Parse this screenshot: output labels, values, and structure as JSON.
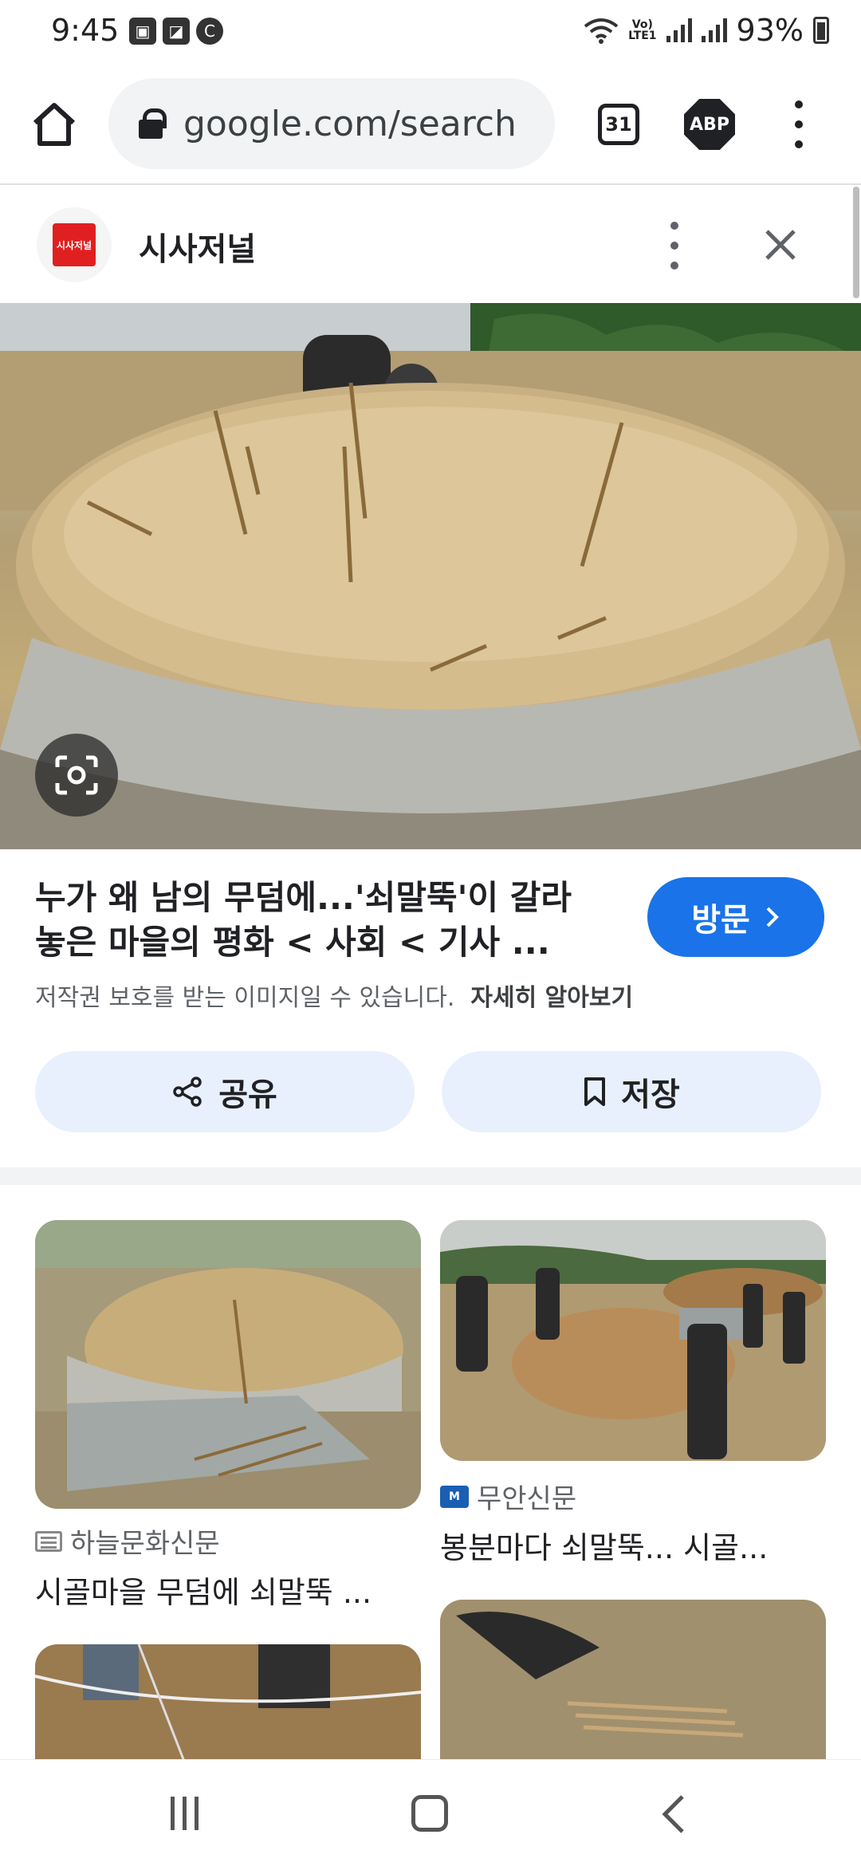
{
  "status": {
    "time": "9:45",
    "battery": "93%",
    "network": "LTE1"
  },
  "browser": {
    "url": "google.com/search",
    "tab_count": "31",
    "adblock_label": "ABP"
  },
  "source": {
    "name": "시사저널",
    "logo_text": "시사저널"
  },
  "result": {
    "title_line1": "누가 왜 남의 무덤에...'쇠말뚝'이 갈라",
    "title_line2": "놓은 마을의 평화 < 사회 < 기사 ...",
    "visit_label": "방문",
    "copyright": "저작권 보호를 받는 이미지일 수 있습니다.",
    "learn_more": "자세히 알아보기",
    "share_label": "공유",
    "save_label": "저장"
  },
  "related": [
    {
      "source": "하늘문화신문",
      "title": "시골마을 무덤에 쇠말뚝 ..."
    },
    {
      "source": "무안신문",
      "title": "봉분마다 쇠말뚝... 시골..."
    }
  ],
  "colors": {
    "accent": "#1a73e8",
    "action_bg": "#e8f0fe",
    "url_bg": "#f1f3f4"
  }
}
